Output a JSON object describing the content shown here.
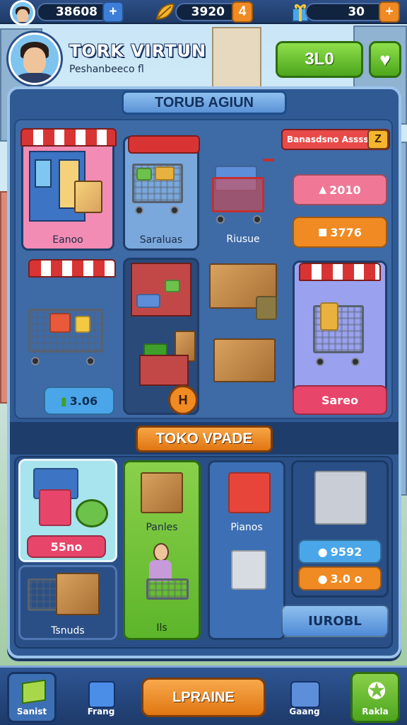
{
  "top_bar": {
    "stat1_value": "38608",
    "stat1_button": "+",
    "stat2_value": "3920",
    "stat2_button": "4",
    "stat3_value": "30",
    "stat3_button": "+"
  },
  "header": {
    "player_name": "TORK VIRTUN",
    "player_subtitle": "Peshanbeeco fl",
    "coin_button": "3L0",
    "heart_button": "♥"
  },
  "panel": {
    "title": "TORUB AGIUN",
    "sort_label": "Banasdsno Assss",
    "sort_button": "Z",
    "shop_cards": [
      {
        "label": "Eanoo"
      },
      {
        "label": "Saraluas"
      },
      {
        "label": "Riusue"
      },
      {
        "label": "Sareo"
      }
    ],
    "price_tags": [
      "2010",
      "3776"
    ],
    "green_price": "3.06",
    "badge": "H",
    "upgrade_title": "TOKO VPADE",
    "upgrade_cards": [
      {
        "price": "55no",
        "label": "Tsnuds"
      },
      {
        "label": "Panles",
        "sublabel": "Ils"
      },
      {
        "label": "Pianos"
      },
      {
        "price1": "9592",
        "price2": "3.0 o"
      }
    ],
    "upgrade_action": "IUROBL"
  },
  "bottom_nav": {
    "items": [
      {
        "label": "Sanist"
      },
      {
        "label": "Frang"
      },
      {
        "label": "LPRAINE"
      },
      {
        "label": "Gaang"
      },
      {
        "label": "Rakla"
      }
    ]
  },
  "colors": {
    "panel_bg": "#2f5a94",
    "green_button": "#5cb52a",
    "orange_button": "#f08a22",
    "pink_card": "#f28cb4",
    "red_price": "#e8456a"
  }
}
